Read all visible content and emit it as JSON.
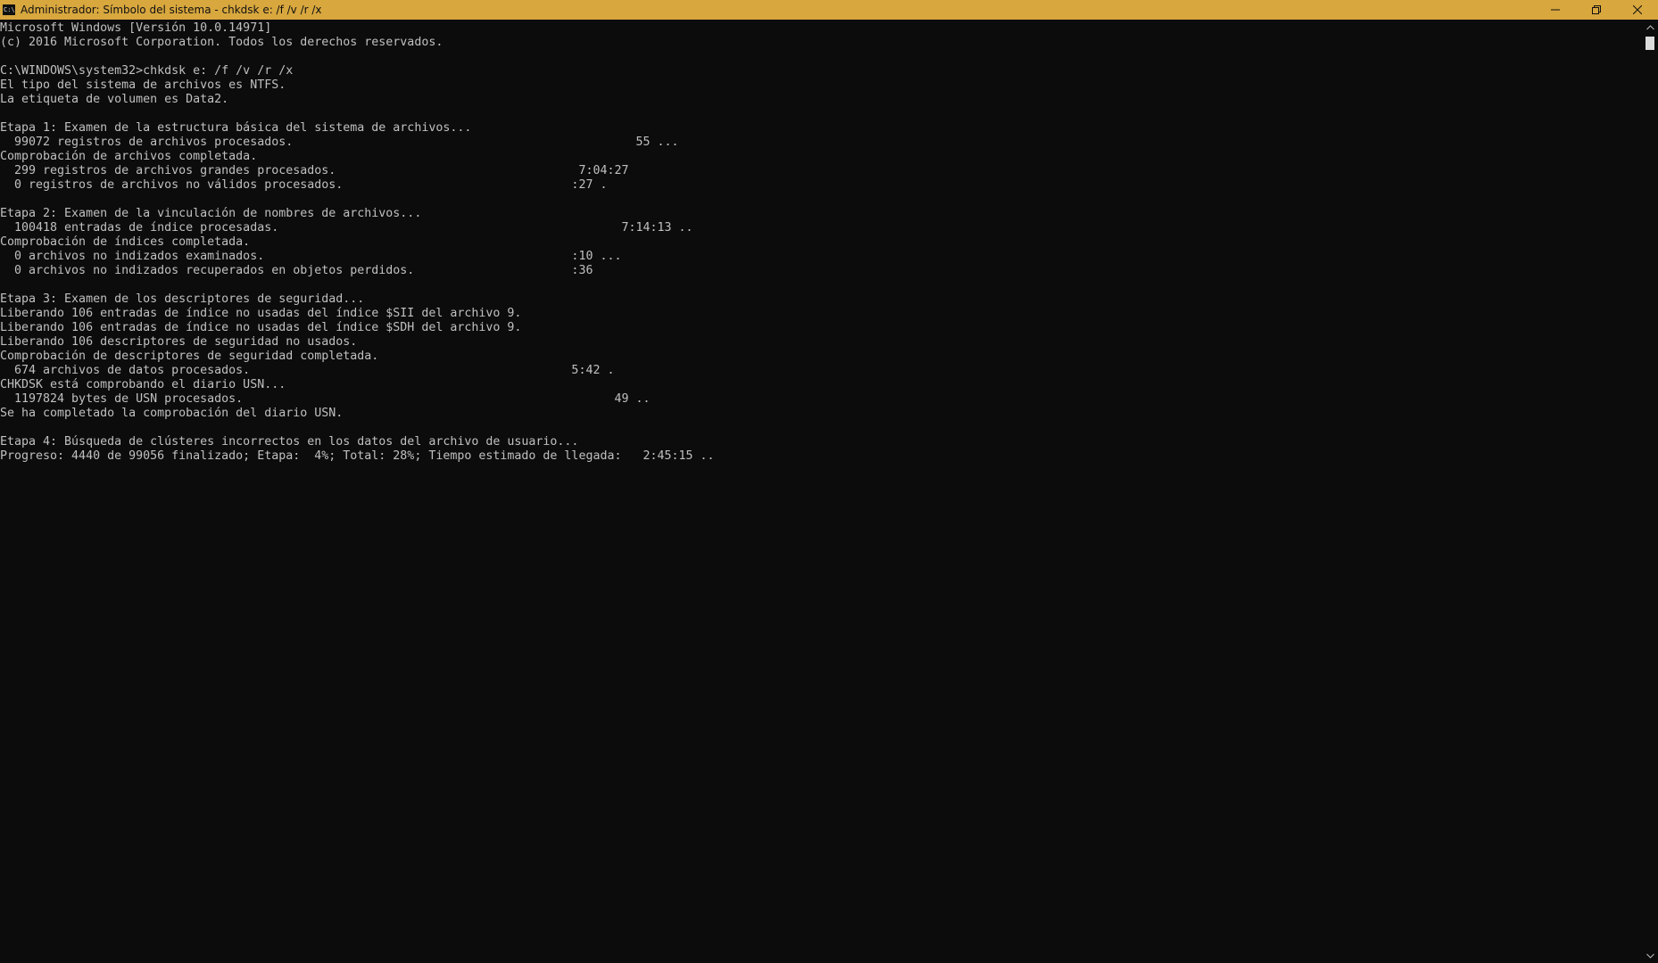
{
  "window": {
    "title": "Administrador: Símbolo del sistema - chkdsk  e: /f /v /r /x",
    "icon_label": "C:\\",
    "controls": {
      "minimize_icon": "minimize-icon",
      "restore_icon": "restore-icon",
      "close_icon": "close-icon"
    }
  },
  "console": {
    "background": "#0c0c0c",
    "foreground": "#c0c0c0",
    "lines": [
      "Microsoft Windows [Versión 10.0.14971]",
      "(c) 2016 Microsoft Corporation. Todos los derechos reservados.",
      "",
      "C:\\WINDOWS\\system32>chkdsk e: /f /v /r /x",
      "El tipo del sistema de archivos es NTFS.",
      "La etiqueta de volumen es Data2.",
      "",
      "Etapa 1: Examen de la estructura básica del sistema de archivos...",
      "  99072 registros de archivos procesados.                                                55 ...",
      "Comprobación de archivos completada.",
      "  299 registros de archivos grandes procesados.                                  7:04:27",
      "  0 registros de archivos no válidos procesados.                                :27 .",
      "",
      "Etapa 2: Examen de la vinculación de nombres de archivos...",
      "  100418 entradas de índice procesadas.                                                7:14:13 ..",
      "Comprobación de índices completada.",
      "  0 archivos no indizados examinados.                                           :10 ...",
      "  0 archivos no indizados recuperados en objetos perdidos.                      :36",
      "",
      "Etapa 3: Examen de los descriptores de seguridad...",
      "Liberando 106 entradas de índice no usadas del índice $SII del archivo 9.",
      "Liberando 106 entradas de índice no usadas del índice $SDH del archivo 9.",
      "Liberando 106 descriptores de seguridad no usados.",
      "Comprobación de descriptores de seguridad completada.",
      "  674 archivos de datos procesados.                                             5:42 .",
      "CHKDSK está comprobando el diario USN...",
      "  1197824 bytes de USN procesados.                                                    49 ..",
      "Se ha completado la comprobación del diario USN.",
      "",
      "Etapa 4: Búsqueda de clústeres incorrectos en los datos del archivo de usuario...",
      "Progreso: 4440 de 99056 finalizado; Etapa:  4%; Total: 28%; Tiempo estimado de llegada:   2:45:15 .."
    ]
  },
  "scrollbar": {
    "up_icon": "scroll-up-arrow-icon",
    "down_icon": "scroll-down-arrow-icon",
    "thumb_color": "#dcdcdc"
  },
  "colors": {
    "titlebar": "#d8a73e"
  }
}
